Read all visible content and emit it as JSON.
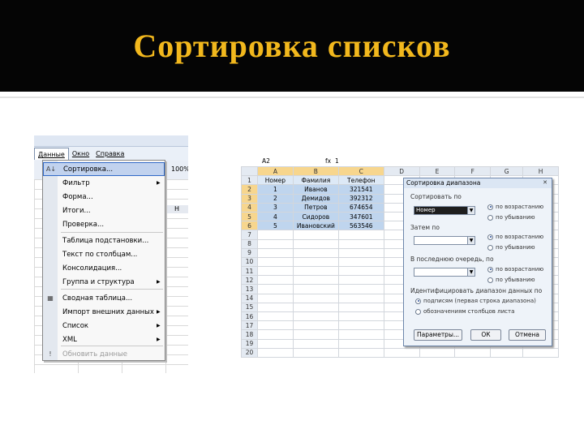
{
  "slide": {
    "title": "Сортировка списков"
  },
  "excel2003": {
    "menubar": [
      "Данные",
      "Окно",
      "Справка"
    ],
    "zoom": "100%",
    "col_label": "H",
    "menu": [
      {
        "label": "Сортировка...",
        "icon": "sort-icon",
        "selected": true,
        "arrow": false,
        "disabled": false
      },
      {
        "label": "Фильтр",
        "icon": "",
        "selected": false,
        "arrow": true,
        "disabled": false
      },
      {
        "label": "Форма...",
        "icon": "",
        "selected": false,
        "arrow": false,
        "disabled": false
      },
      {
        "label": "Итоги...",
        "icon": "",
        "selected": false,
        "arrow": false,
        "disabled": false
      },
      {
        "label": "Проверка...",
        "icon": "",
        "selected": false,
        "arrow": false,
        "disabled": false
      },
      {
        "label": "Таблица подстановки...",
        "icon": "",
        "selected": false,
        "arrow": false,
        "disabled": false
      },
      {
        "label": "Текст по столбцам...",
        "icon": "",
        "selected": false,
        "arrow": false,
        "disabled": false
      },
      {
        "label": "Консолидация...",
        "icon": "",
        "selected": false,
        "arrow": false,
        "disabled": false
      },
      {
        "label": "Группа и структура",
        "icon": "",
        "selected": false,
        "arrow": true,
        "disabled": false
      },
      {
        "label": "Сводная таблица...",
        "icon": "pivot-table-icon",
        "selected": false,
        "arrow": false,
        "disabled": false
      },
      {
        "label": "Импорт внешних данных",
        "icon": "",
        "selected": false,
        "arrow": true,
        "disabled": false
      },
      {
        "label": "Список",
        "icon": "",
        "selected": false,
        "arrow": true,
        "disabled": false
      },
      {
        "label": "XML",
        "icon": "",
        "selected": false,
        "arrow": true,
        "disabled": false
      },
      {
        "label": "Обновить данные",
        "icon": "refresh-icon",
        "selected": false,
        "arrow": false,
        "disabled": true
      }
    ]
  },
  "sheet": {
    "name_box": "A2",
    "formula_value": "1",
    "columns": [
      "A",
      "B",
      "C",
      "D",
      "E",
      "F",
      "G",
      "H"
    ],
    "header_row": [
      "Номер",
      "Фамилия",
      "Телефон"
    ],
    "rows": [
      [
        "1",
        "Иванов",
        "321541"
      ],
      [
        "2",
        "Демидов",
        "392312"
      ],
      [
        "3",
        "Петров",
        "674654"
      ],
      [
        "4",
        "Сидоров",
        "347601"
      ],
      [
        "5",
        "Ивановский",
        "563546"
      ]
    ],
    "row_numbers": [
      "1",
      "2",
      "3",
      "4",
      "5",
      "6",
      "7",
      "8",
      "9",
      "10",
      "11",
      "12",
      "13",
      "14",
      "15",
      "16",
      "17",
      "18",
      "19",
      "20"
    ]
  },
  "sort_dialog": {
    "title": "Сортировка диапазона",
    "sort_by_label": "Сортировать по",
    "sort_by_value": "Номер",
    "then_by_label": "Затем по",
    "last_by_label": "В последнюю очередь, по",
    "asc": "по возрастанию",
    "desc": "по убыванию",
    "identify_label": "Идентифицировать диапазон данных по",
    "opt_headers": "подписям (первая строка диапазона)",
    "opt_letters": "обозначениям столбцов листа",
    "btn_params": "Параметры...",
    "btn_ok": "ОК",
    "btn_cancel": "Отмена"
  }
}
